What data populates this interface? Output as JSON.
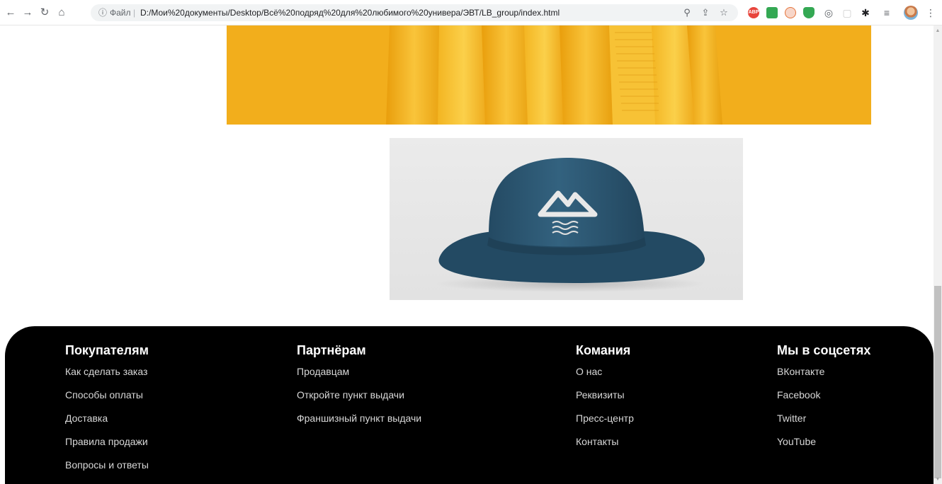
{
  "browser": {
    "info_icon": "info-circle-icon",
    "scheme_label": "Файл",
    "separator": "|",
    "url": "D:/Мои%20документы/Desktop/Всё%20подряд%20для%20любимого%20универа/ЭВТ/LB_group/index.html",
    "extensions": [
      {
        "name": "adblock-extension",
        "label": "ABP",
        "color": "#e8453c"
      },
      {
        "name": "extension-2",
        "label": "",
        "color": "#34a853"
      },
      {
        "name": "extension-3",
        "label": "",
        "color": "#e5733a"
      },
      {
        "name": "shield-extension",
        "label": "",
        "color": "#34a853"
      }
    ]
  },
  "footer": {
    "columns": [
      {
        "title": "Покупателям",
        "links": [
          "Как сделать заказ",
          "Способы оплаты",
          "Доставка",
          "Правила продажи",
          "Вопросы и ответы"
        ]
      },
      {
        "title": "Партнёрам",
        "links": [
          "Продавцам",
          "Откройте пункт выдачи",
          "Франшизный пункт выдачи"
        ]
      },
      {
        "title": "Комания",
        "links": [
          "О нас",
          "Реквизиты",
          "Пресс-центр",
          "Контакты"
        ]
      },
      {
        "title": "Мы в соцсетях",
        "links": [
          "ВКонтакте",
          "Facebook",
          "Twitter",
          "YouTube"
        ]
      }
    ]
  },
  "colors": {
    "banner": "#f3b11f",
    "footer_bg": "#000000",
    "hat": "#2d5875"
  }
}
